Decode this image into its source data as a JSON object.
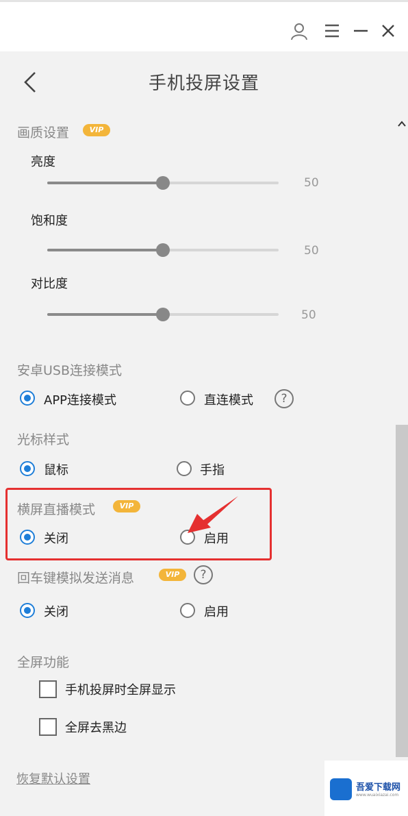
{
  "window": {
    "title": "手机投屏设置",
    "icons": [
      "user-icon",
      "menu-icon",
      "minimize-icon",
      "close-icon",
      "back-icon"
    ]
  },
  "picture": {
    "title": "画质设置",
    "vip": "VIP",
    "sliders": [
      {
        "label": "亮度",
        "value": "50",
        "fraction": 0.5
      },
      {
        "label": "饱和度",
        "value": "50",
        "fraction": 0.5
      },
      {
        "label": "对比度",
        "value": "50",
        "fraction": 0.5
      }
    ]
  },
  "usb_mode": {
    "title": "安卓USB连接模式",
    "options": [
      "APP连接模式",
      "直连模式"
    ],
    "selected": 0
  },
  "cursor_style": {
    "title": "光标样式",
    "options": [
      "鼠标",
      "手指"
    ],
    "selected": 0
  },
  "landscape_live": {
    "title": "横屏直播模式",
    "vip": "VIP",
    "options": [
      "关闭",
      "启用"
    ],
    "selected": 0
  },
  "enter_key": {
    "title": "回车键模拟发送消息",
    "vip": "VIP",
    "options": [
      "关闭",
      "启用"
    ],
    "selected": 0
  },
  "fullscreen": {
    "title": "全屏功能",
    "options": [
      "手机投屏时全屏显示",
      "全屏去黑边"
    ],
    "checked": [
      false,
      false
    ]
  },
  "restore_label": "恢复默认设置",
  "watermark": {
    "name": "吾爱下载网",
    "url": "www.wuaixiazai.com"
  },
  "colors": {
    "accent": "#1e7ed8",
    "vip_badge": "#f3b53a",
    "highlight_box": "#e53030"
  }
}
